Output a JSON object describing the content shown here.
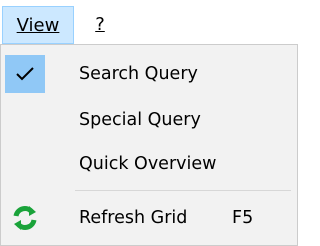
{
  "menubar": {
    "items": [
      {
        "label": "View",
        "active": true
      },
      {
        "label": "?",
        "active": false
      }
    ]
  },
  "menu": {
    "items": [
      {
        "label": "Search Query",
        "checked": true,
        "icon": "checkmark-icon"
      },
      {
        "label": "Special Query",
        "checked": false
      },
      {
        "label": "Quick Overview",
        "checked": false
      },
      {
        "label": "Refresh Grid",
        "shortcut": "F5",
        "icon": "refresh-icon"
      }
    ]
  },
  "colors": {
    "menubar_active_bg": "#cce8ff",
    "menubar_active_border": "#99d1ff",
    "checked_bg": "#90c8f6",
    "dropdown_bg": "#f2f2f2",
    "refresh_icon_green": "#1aa33a"
  }
}
